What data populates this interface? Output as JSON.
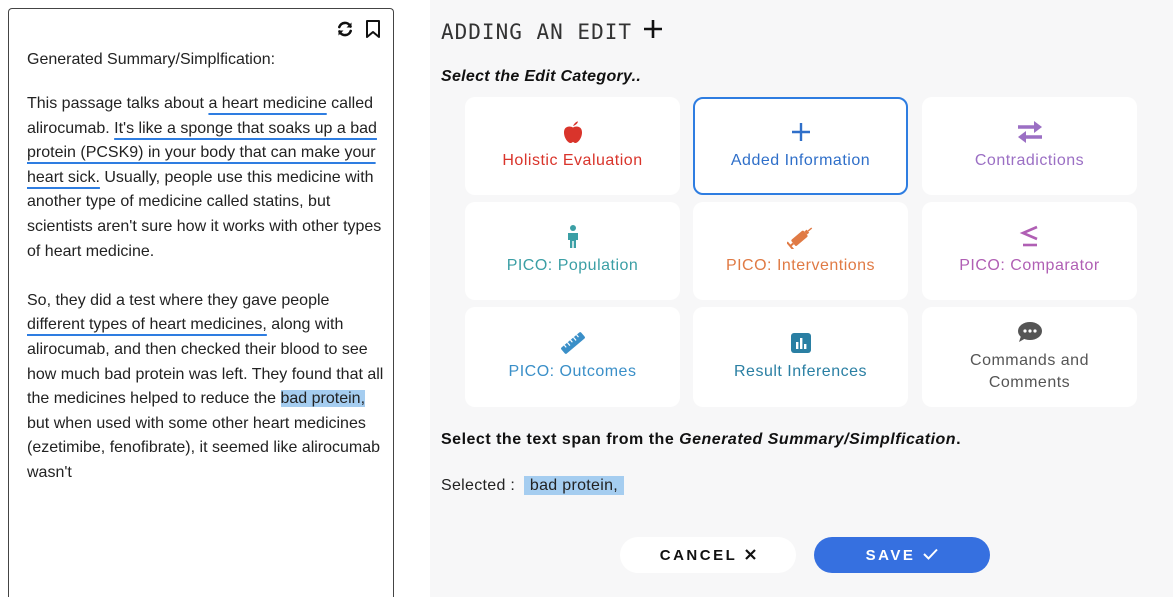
{
  "summary_panel": {
    "heading": "Generated Summary/Simplfication:",
    "icons": [
      "refresh-icon",
      "bookmark-icon"
    ],
    "p1": {
      "s1": "This passage talks about ",
      "u1": "a heart medicine",
      "s2": " called alirocumab. ",
      "u2": "It's like a sponge that soaks up a bad protein (PCSK9) in your body that can make your heart sick.",
      "s3": " Usually, people use this medicine with another type of medicine called statins, but scientists aren't sure how it works with other types of heart medicine."
    },
    "p2": {
      "s1": "So, they did a test where they gave people ",
      "u1": "different types of heart medicines,",
      "s2": " along with alirocumab, and then checked their blood to see how much bad protein was left. They found that all the medicines helped to reduce the ",
      "h1": "bad protein,",
      "s3": " but when used with some other heart medicines (ezetimibe, fenofibrate), it seemed like alirocumab wasn't"
    }
  },
  "edit_panel": {
    "title": "ADDING AN EDIT",
    "category_prompt": "Select the Edit Category..",
    "categories": [
      {
        "label": "Holistic Evaluation",
        "icon": "apple-icon",
        "color": "#d9342b"
      },
      {
        "label": "Added Information",
        "icon": "plus-icon",
        "color": "#2f6fc9"
      },
      {
        "label": "Contradictions",
        "icon": "swap-arrows-icon",
        "color": "#9b6fc4"
      },
      {
        "label": "PICO: Population",
        "icon": "person-icon",
        "color": "#3b9fa5"
      },
      {
        "label": "PICO: Interventions",
        "icon": "syringe-icon",
        "color": "#e07a44"
      },
      {
        "label": "PICO: Comparator",
        "icon": "less-equal-icon",
        "color": "#b05fb4"
      },
      {
        "label": "PICO: Outcomes",
        "icon": "ruler-icon",
        "color": "#3a8fc8"
      },
      {
        "label": "Result Inferences",
        "icon": "bar-chart-icon",
        "color": "#2a7fa3"
      },
      {
        "label": "Commands and Comments",
        "icon": "comment-icon",
        "color": "#555555"
      }
    ],
    "selected_category": "Added Information",
    "span_prompt_pre": "Select the text span from the ",
    "span_prompt_em": "Generated Summary/Simplfication",
    "span_prompt_post": ".",
    "selected_label": "Selected :",
    "selected_value": "bad protein,",
    "cancel_label": "CANCEL",
    "save_label": "SAVE",
    "accent": "#3670e0"
  }
}
